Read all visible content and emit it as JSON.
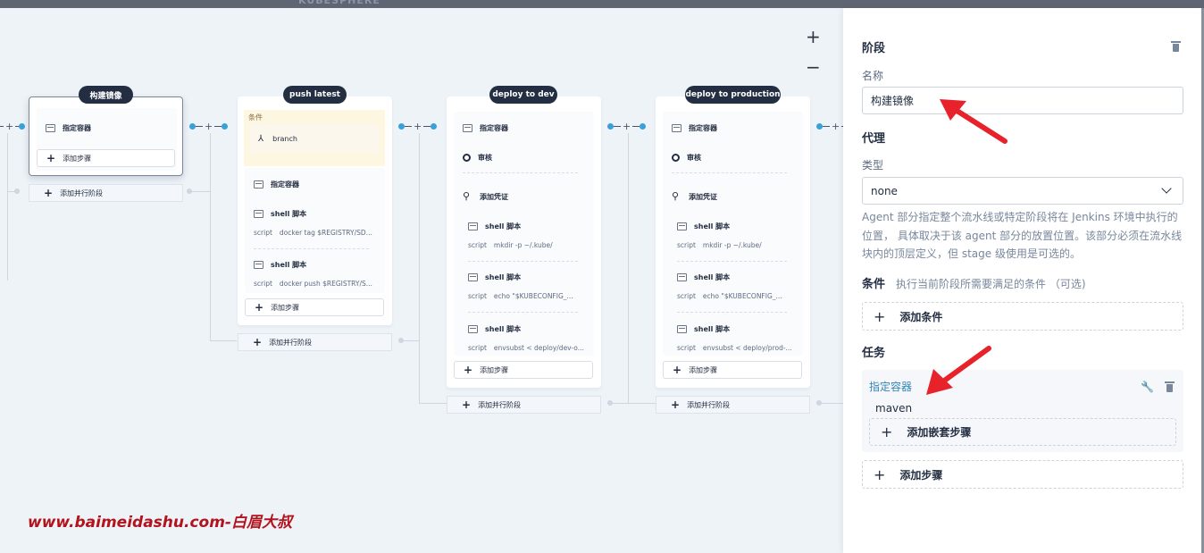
{
  "app": {
    "logo_text": "KUBESPHERE"
  },
  "canvas": {
    "zoom_in": "+",
    "zoom_out": "−",
    "add_step_label": "添加步骤",
    "add_parallel_label": "添加并行阶段",
    "stages": [
      {
        "name": "构建镜像",
        "selected": true,
        "steps": [
          {
            "title": "指定容器"
          }
        ]
      },
      {
        "name": "push latest",
        "condition_label": "条件",
        "condition_item": "branch",
        "steps": [
          {
            "title": "指定容器"
          },
          {
            "title": "shell 脚本",
            "key": "script",
            "value": "docker tag $REGISTRY/SD..."
          },
          {
            "title": "shell 脚本",
            "key": "script",
            "value": "docker push $REGISTRY/S..."
          }
        ]
      },
      {
        "name": "deploy to dev",
        "steps": [
          {
            "title": "指定容器"
          },
          {
            "title": "审核"
          },
          {
            "title": "添加凭证"
          },
          {
            "title": "shell 脚本",
            "key": "script",
            "value": "mkdir -p ~/.kube/"
          },
          {
            "title": "shell 脚本",
            "key": "script",
            "value": "echo \"$KUBECONFIG_..."
          },
          {
            "title": "shell 脚本",
            "key": "script",
            "value": "envsubst < deploy/dev-o..."
          }
        ]
      },
      {
        "name": "deploy to production",
        "steps": [
          {
            "title": "指定容器"
          },
          {
            "title": "审核"
          },
          {
            "title": "添加凭证"
          },
          {
            "title": "shell 脚本",
            "key": "script",
            "value": "mkdir -p ~/.kube/"
          },
          {
            "title": "shell 脚本",
            "key": "script",
            "value": "echo \"$KUBECONFIG_..."
          },
          {
            "title": "shell 脚本",
            "key": "script",
            "value": "envsubst < deploy/prod-..."
          }
        ]
      }
    ]
  },
  "watermark": "www.baimeidashu.com-白眉大叔",
  "panel": {
    "stage_heading": "阶段",
    "name_label": "名称",
    "name_value": "构建镜像",
    "agent_heading": "代理",
    "type_label": "类型",
    "type_value": "none",
    "agent_desc": "Agent 部分指定整个流水线或特定阶段将在 Jenkins 环境中执行的位置， 具体取决于该 agent 部分的放置位置。该部分必须在流水线块内的顶层定义，但 stage 级使用是可选的。",
    "condition_heading": "条件",
    "condition_desc": "执行当前阶段所需要满足的条件 （可选)",
    "add_condition": "添加条件",
    "task_heading": "任务",
    "task_title": "指定容器",
    "task_value": "maven",
    "add_nested_step": "添加嵌套步骤",
    "add_step": "添加步骤"
  },
  "colors": {
    "accent": "#3aa0d8",
    "pill": "#242e42",
    "arrow": "#e8222a",
    "watermark": "#b3131c"
  }
}
